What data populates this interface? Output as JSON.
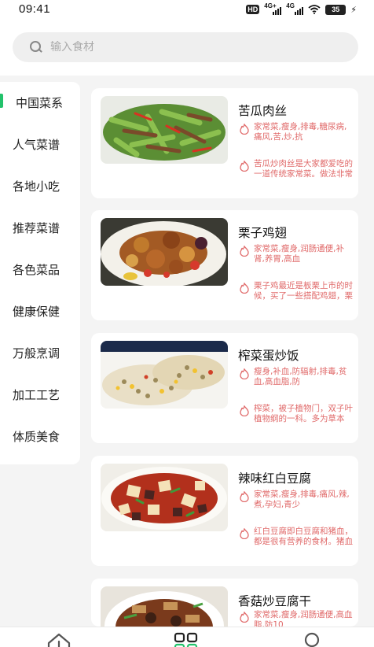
{
  "status_bar": {
    "time": "09:41",
    "hd_label": "HD",
    "network_1": "4G+",
    "network_2": "4G",
    "battery": "35"
  },
  "search": {
    "placeholder": "输入食材"
  },
  "sidebar": {
    "items": [
      {
        "label": "中国菜系",
        "active": true
      },
      {
        "label": "人气菜谱",
        "active": false
      },
      {
        "label": "各地小吃",
        "active": false
      },
      {
        "label": "推荐菜谱",
        "active": false
      },
      {
        "label": "各色菜品",
        "active": false
      },
      {
        "label": "健康保健",
        "active": false
      },
      {
        "label": "万般烹调",
        "active": false
      },
      {
        "label": "加工工艺",
        "active": false
      },
      {
        "label": "体质美食",
        "active": false
      }
    ]
  },
  "recipes": [
    {
      "title": "苦瓜肉丝",
      "tags": "家常菜,瘦身,排毒,糖尿病,痛风,苦,炒,抗",
      "description": "苦瓜炒肉丝是大家都爱吃的一道传统家常菜。做法非常"
    },
    {
      "title": "栗子鸡翅",
      "tags": "家常菜,瘦身,润肠通便,补肾,养胃,高血",
      "description": "栗子鸡最近是板栗上市的时候，买了一些搭配鸡翅，栗"
    },
    {
      "title": "榨菜蛋炒饭",
      "tags": "瘦身,补血,防辐射,排毒,贫血,高血脂,防",
      "description": "榨菜，被子植物门，双子叶植物纲的一科。多为草本"
    },
    {
      "title": "辣味红白豆腐",
      "tags": "家常菜,瘦身,排毒,痛风,辣,煮,孕妇,青少",
      "description": "红白豆腐即白豆腐和猪血，都是很有营养的食材。猪血"
    },
    {
      "title": "香菇炒豆腐干",
      "tags": "家常菜,瘦身,润肠通便,高血脂,防10",
      "description": ""
    }
  ],
  "colors": {
    "accent": "#22c26b",
    "tag_text": "#e06a6a",
    "background": "#f4f4f4"
  },
  "icons": {
    "tag_icon": "flame-icon",
    "search_icon": "search-icon",
    "nav": [
      "home-icon",
      "category-grid-icon",
      "profile-icon"
    ]
  }
}
